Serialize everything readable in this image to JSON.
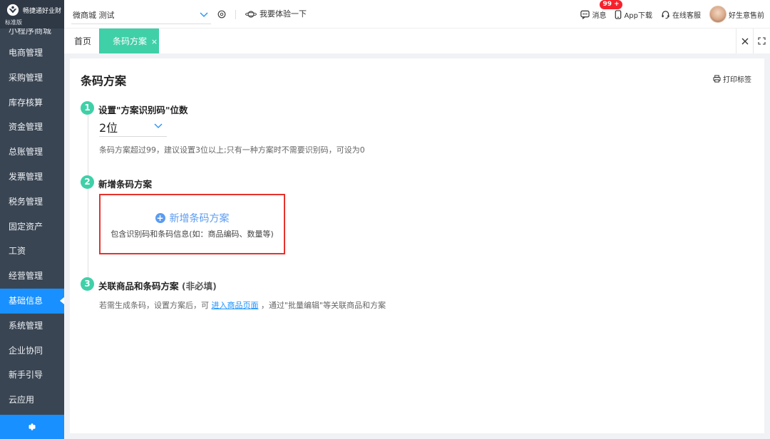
{
  "brand": {
    "name": "畅捷通好业财",
    "edition": "标准版"
  },
  "sidebar": {
    "partial_item": "小程序商城",
    "items": [
      {
        "label": "电商管理",
        "active": false
      },
      {
        "label": "采购管理",
        "active": false
      },
      {
        "label": "库存核算",
        "active": false
      },
      {
        "label": "资金管理",
        "active": false
      },
      {
        "label": "总账管理",
        "active": false
      },
      {
        "label": "发票管理",
        "active": false
      },
      {
        "label": "税务管理",
        "active": false
      },
      {
        "label": "固定资产",
        "active": false
      },
      {
        "label": "工资",
        "active": false
      },
      {
        "label": "经营管理",
        "active": false
      },
      {
        "label": "基础信息",
        "active": true
      },
      {
        "label": "系统管理",
        "active": false
      },
      {
        "label": "企业协同",
        "active": false
      },
      {
        "label": "新手引导",
        "active": false
      },
      {
        "label": "云应用",
        "active": false
      }
    ],
    "footer_icon": "gear-icon"
  },
  "topbar": {
    "store_select_value": "微商城 测试",
    "try_label": "我要体验一下",
    "messages_label": "消息",
    "messages_badge": "99 +",
    "app_download_label": "App下载",
    "service_label": "在线客服",
    "user_name": "好生意售前"
  },
  "tabs": {
    "home_label": "首页",
    "active_label": "条码方案",
    "close_glyph": "×"
  },
  "page": {
    "title": "条码方案",
    "print_label": "打印标签",
    "step1": {
      "number": "1",
      "title": "设置\"方案识别码\"位数",
      "select_value": "2位",
      "hint": "条码方案超过99，建议设置3位以上;只有一种方案时不需要识别码，可设为0"
    },
    "step2": {
      "number": "2",
      "title": "新增条码方案",
      "add_label": "新增条码方案",
      "add_desc": "包含识别码和条码信息(如：商品编码、数量等)"
    },
    "step3": {
      "number": "3",
      "title": "关联商品和条码方案",
      "title_optional": "(非必填)",
      "hint_before": "若需生成条码，设置方案后，可",
      "hint_link": "进入商品页面",
      "hint_after": "，通过\"批量编辑\"等关联商品和方案"
    }
  },
  "colors": {
    "sidebar_bg": "#3a4553",
    "accent_blue": "#1890ff",
    "tab_active": "#3fd0a8",
    "step_badge": "#3fd0a8",
    "highlight_border": "#e5322d",
    "link_blue": "#5b9bf2",
    "badge_red": "#f5222d"
  }
}
